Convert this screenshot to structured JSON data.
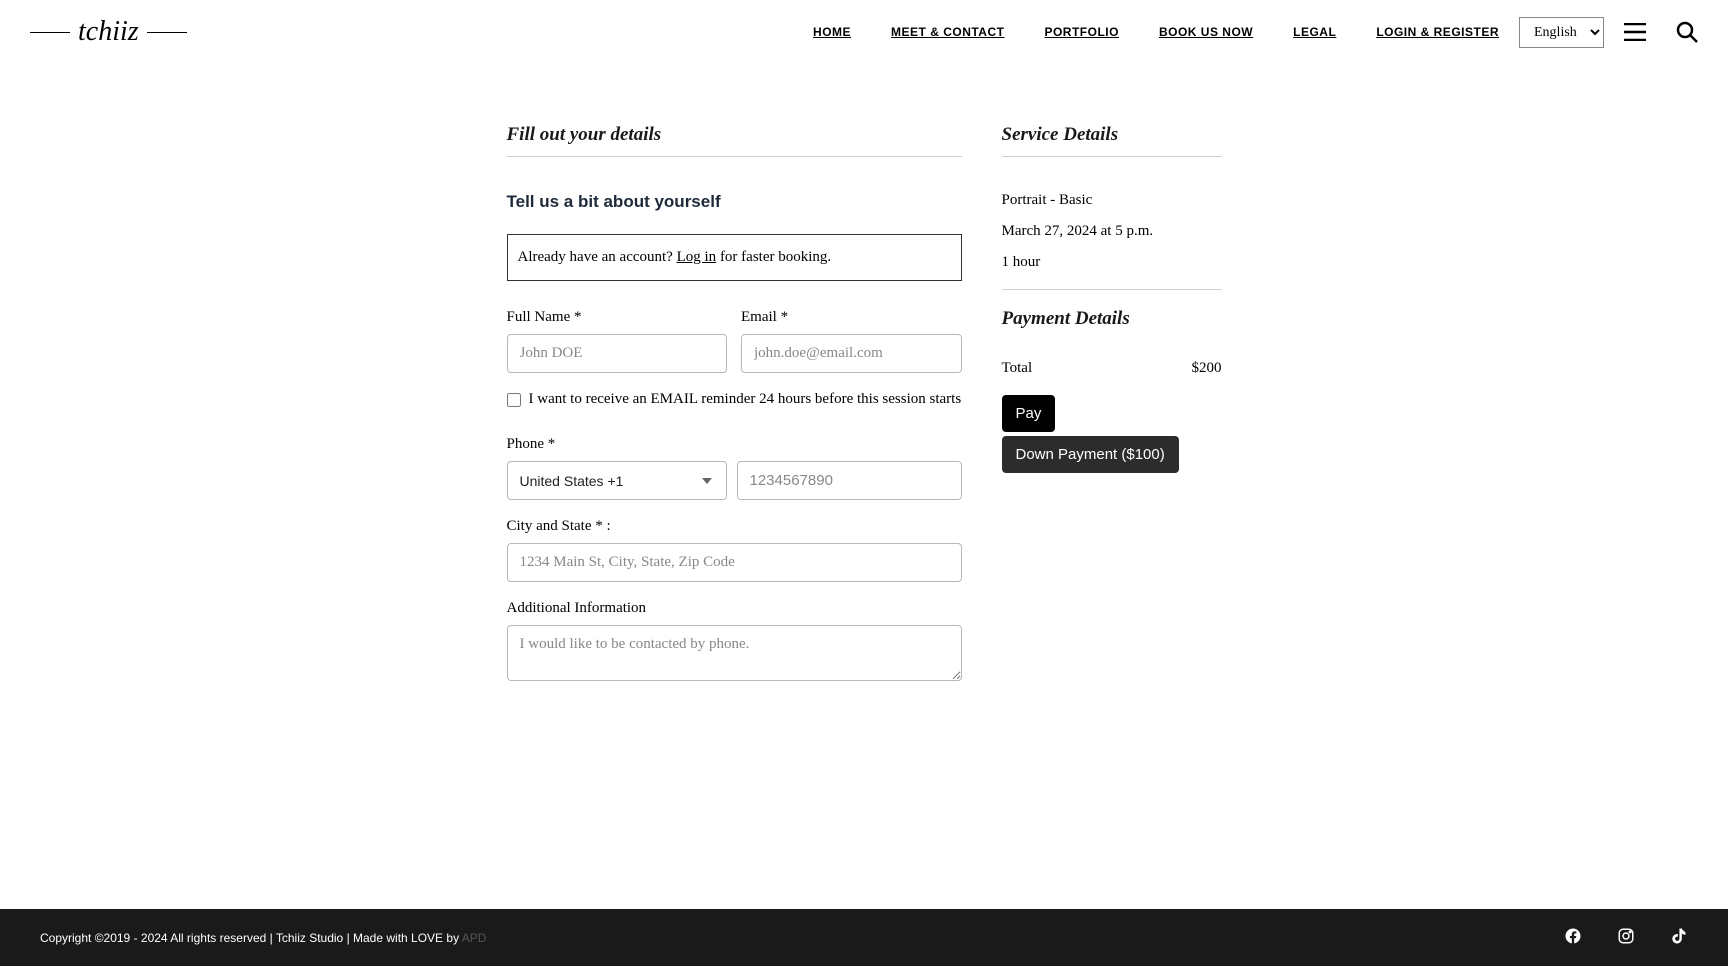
{
  "logo": "tchiiz",
  "nav": [
    "HOME",
    "MEET & CONTACT",
    "PORTFOLIO",
    "BOOK US NOW",
    "LEGAL",
    "LOGIN & REGISTER"
  ],
  "language": "English",
  "form": {
    "title": "Fill out your details",
    "subtitle": "Tell us a bit about yourself",
    "login_prompt_prefix": "Already have an account? ",
    "login_link": "Log in",
    "login_prompt_suffix": " for faster booking.",
    "fullname_label": "Full Name *",
    "fullname_placeholder": "John DOE",
    "email_label": "Email *",
    "email_placeholder": "john.doe@email.com",
    "reminder_checkbox_label": "I want to receive an EMAIL reminder 24 hours before this session starts",
    "phone_label": "Phone *",
    "phone_prefix_selected": "United States +1",
    "phone_placeholder": "1234567890",
    "city_state_label": "City and State * :",
    "city_state_placeholder": "1234 Main St, City, State, Zip Code",
    "additional_label": "Additional Information",
    "additional_placeholder": "I would like to be contacted by phone."
  },
  "service": {
    "title": "Service Details",
    "name": "Portrait - Basic",
    "datetime": "March 27, 2024 at 5 p.m.",
    "duration": "1 hour"
  },
  "payment": {
    "title": "Payment Details",
    "total_label": "Total",
    "total_value": "$200",
    "pay_button": "Pay",
    "down_payment_button": "Down Payment ($100)"
  },
  "footer": {
    "copyright": "Copyright ©2019 - 2024 All rights reserved | Tchiiz Studio | Made with LOVE by ",
    "apd": "APD"
  }
}
